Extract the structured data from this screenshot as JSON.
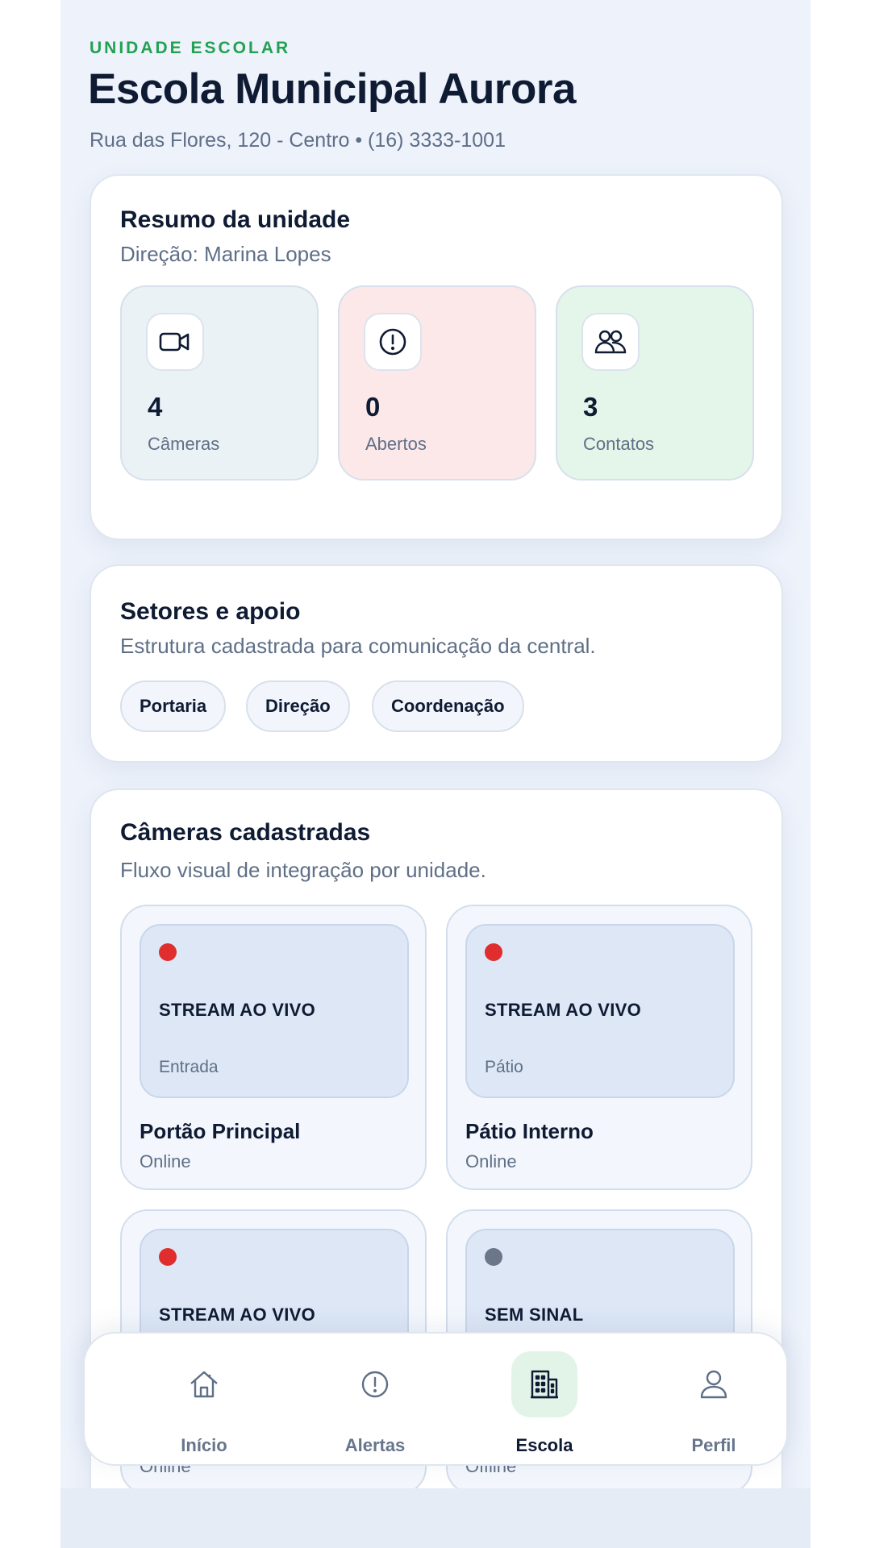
{
  "header": {
    "eyebrow": "UNIDADE ESCOLAR",
    "title": "Escola Municipal Aurora",
    "subtitle": "Rua das Flores, 120 - Centro • (16) 3333-1001"
  },
  "summary": {
    "title": "Resumo da unidade",
    "subtitle": "Direção: Marina Lopes",
    "stats": [
      {
        "value": "4",
        "label": "Câmeras",
        "icon": "video-camera-icon",
        "bg": "#eaf2f6"
      },
      {
        "value": "0",
        "label": "Abertos",
        "icon": "alert-circle-icon",
        "bg": "#fde8e9"
      },
      {
        "value": "3",
        "label": "Contatos",
        "icon": "users-icon",
        "bg": "#e4f5e9"
      }
    ]
  },
  "sectors": {
    "title": "Setores e apoio",
    "subtitle": "Estrutura cadastrada para comunicação da central.",
    "chips": [
      "Portaria",
      "Direção",
      "Coordenação"
    ]
  },
  "cameras": {
    "title": "Câmeras cadastradas",
    "subtitle": "Fluxo visual de integração por unidade.",
    "items": [
      {
        "stream": "STREAM AO VIVO",
        "location": "Entrada",
        "name": "Portão Principal",
        "status": "Online",
        "dot_color": "#e02d2d"
      },
      {
        "stream": "STREAM AO VIVO",
        "location": "Pátio",
        "name": "Pátio Interno",
        "status": "Online",
        "dot_color": "#e02d2d"
      },
      {
        "stream": "STREAM AO VIVO",
        "location": "",
        "name": "",
        "status": "Online",
        "dot_color": "#e02d2d"
      },
      {
        "stream": "SEM SINAL",
        "location": "",
        "name": "",
        "status": "Offline",
        "dot_color": "#6b7789"
      }
    ]
  },
  "nav": {
    "items": [
      {
        "label": "Início",
        "icon": "home-icon"
      },
      {
        "label": "Alertas",
        "icon": "alert-circle-icon"
      },
      {
        "label": "Escola",
        "icon": "building-icon"
      },
      {
        "label": "Perfil",
        "icon": "user-icon"
      }
    ],
    "active_index": 2
  },
  "colors": {
    "accent_green": "#22a152",
    "text_dark": "#0f1b33",
    "text_muted": "#5f6f87",
    "live_red": "#e02d2d",
    "offline_gray": "#6b7789"
  }
}
